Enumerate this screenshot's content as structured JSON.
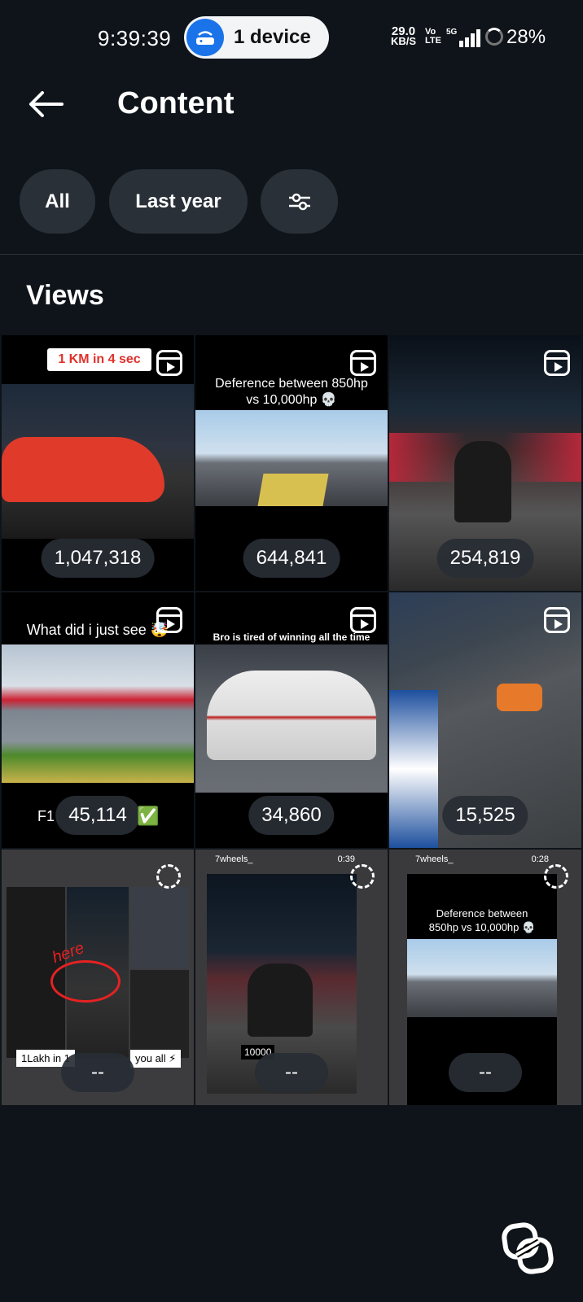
{
  "status": {
    "time": "9:39:39",
    "hotspot": "1 device",
    "speed_value": "29.0",
    "speed_unit": "KB/S",
    "volte_top": "Vo",
    "volte_bottom": "LTE",
    "network": "5G",
    "battery": "28%"
  },
  "header": {
    "title": "Content"
  },
  "filters": {
    "all": "All",
    "period": "Last year"
  },
  "section": {
    "title": "Views"
  },
  "tiles": [
    {
      "views": "1,047,318",
      "caption": "1 KM in 4 sec",
      "type": "reel"
    },
    {
      "views": "644,841",
      "caption": "Deference between 850hp vs 10,000hp 💀",
      "type": "reel"
    },
    {
      "views": "254,819",
      "caption": "",
      "type": "reel"
    },
    {
      "views": "45,114",
      "caption": "What did i just see 🤯",
      "sub": "F1",
      "check": "✅",
      "type": "reel"
    },
    {
      "views": "34,860",
      "caption": "Bro is tired of winning all the time",
      "type": "reel"
    },
    {
      "views": "15,525",
      "caption": "",
      "type": "reel"
    },
    {
      "views": "--",
      "caption": "here",
      "sub": "1Lakh in 1",
      "sub2": "you all ⚡",
      "type": "loading"
    },
    {
      "views": "--",
      "handle": "7wheels_",
      "duration": "0:39",
      "sub": "10000",
      "type": "loading"
    },
    {
      "views": "--",
      "handle": "7wheels_",
      "duration": "0:28",
      "caption": "Deference between 850hp vs 10,000hp 💀",
      "type": "loading"
    }
  ]
}
